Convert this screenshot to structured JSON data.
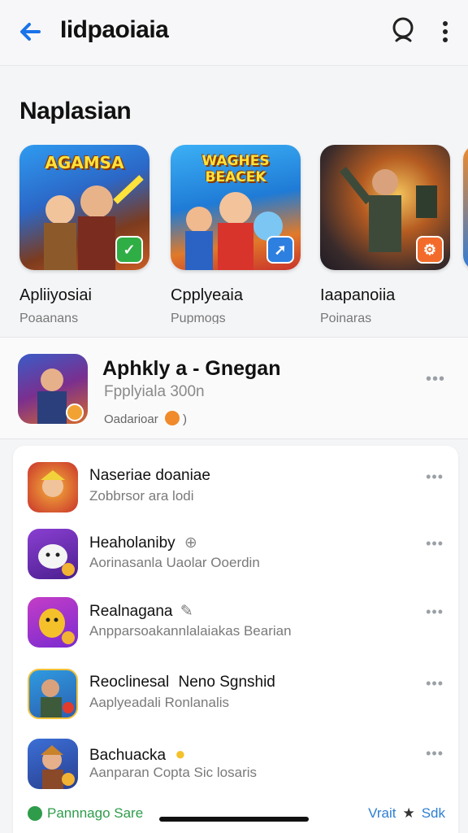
{
  "header": {
    "title": "Iidpaoiaia",
    "back_icon": "arrow-left-icon",
    "search_icon": "search-icon",
    "more_icon": "more-vertical-icon",
    "accent": "#1a73e8"
  },
  "section": {
    "title": "Naplasian"
  },
  "carousel": [
    {
      "caption": "AGAMSA",
      "name": "Apliiyosiai",
      "sub": "Poaanans",
      "badge_icon": "check-icon",
      "badge_color": "#2fae45"
    },
    {
      "caption": "WAGHES BEACEK",
      "name": "Cpplyeaia",
      "sub": "Pupmogs",
      "badge_icon": "arrow-icon",
      "badge_color": "#2d7fe0"
    },
    {
      "caption": "",
      "name": "Iaapanoiia",
      "sub": "Poinaras",
      "badge_icon": "controller-icon",
      "badge_color": "#f36b2b"
    }
  ],
  "feature": {
    "title": "Aphkly a - Gnegan",
    "subtitle": "Fpplyiala 300n",
    "meta": "Oadarioar",
    "meta_suffix": ")",
    "more": "•••"
  },
  "list": [
    {
      "name": "Naseriae doaniae",
      "sub": "Zobbrsor ara lodi",
      "more": "•••"
    },
    {
      "name": "Heaholaniby",
      "name_suffix": "⊕",
      "sub": "Aorinasanla Uaolar Ooerdin",
      "more": "•••"
    },
    {
      "name": "Realnagana",
      "name_suffix": "✎",
      "sub": "Anpparsoakannlalaiakas Bearian",
      "more": "•••"
    },
    {
      "name": "Reoclinesal",
      "name_suffix": "Neno Sgnshid",
      "sub": "Aaplyeadali Ronlanalis",
      "more": "•••"
    },
    {
      "name": "Bachuacka",
      "name_suffix": "●",
      "sub": "Aanparan Copta Sic losaris",
      "more": "•••"
    }
  ],
  "footer": {
    "left_label": "Pannnago Sare",
    "right_label_1": "Vrait",
    "right_label_2": "Sdk"
  }
}
